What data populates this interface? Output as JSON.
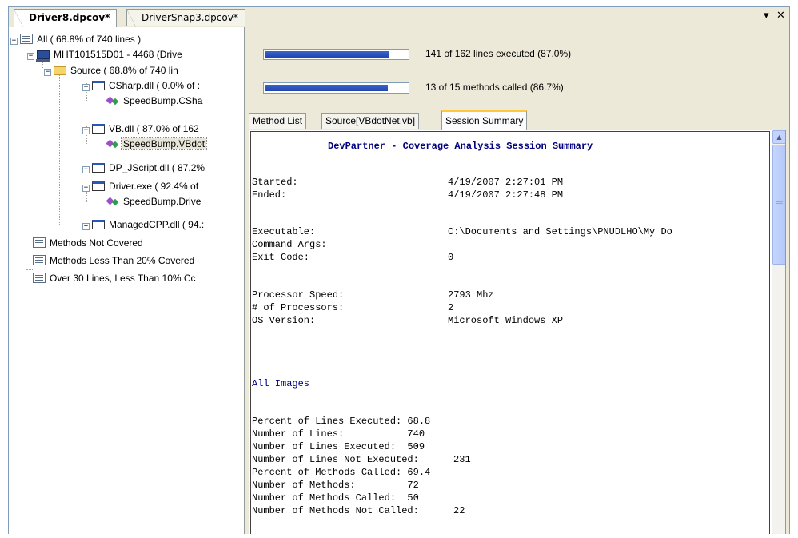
{
  "tabs": [
    {
      "label": "Driver8.dpcov*"
    },
    {
      "label": "DriverSnap3.dpcov*"
    }
  ],
  "controls": {
    "dropdown_icon": "chevron-down-icon",
    "close_icon": "close-icon"
  },
  "tree": {
    "nodes": [
      {
        "label": "All ( 68.8% of 740 lines )",
        "icon": "list-icon"
      },
      {
        "label": "MHT101515D01 - 4468 (Drive",
        "icon": "computer-icon"
      },
      {
        "label": "Source ( 68.8% of 740 lin",
        "icon": "folder-icon"
      },
      {
        "label": "CSharp.dll ( 0.0% of :",
        "icon": "module-icon"
      },
      {
        "label": "SpeedBump.CSha",
        "icon": "class-icon"
      },
      {
        "label": "VB.dll ( 87.0% of 162",
        "icon": "module-icon"
      },
      {
        "label": "SpeedBump.VBdot",
        "icon": "class-icon"
      },
      {
        "label": "DP_JScript.dll ( 87.2%",
        "icon": "module-icon"
      },
      {
        "label": "Driver.exe ( 92.4% of",
        "icon": "module-icon"
      },
      {
        "label": "SpeedBump.Drive",
        "icon": "class-icon"
      },
      {
        "label": "ManagedCPP.dll ( 94.:",
        "icon": "module-icon"
      },
      {
        "label": "Methods Not Covered",
        "icon": "list-icon"
      },
      {
        "label": "Methods Less Than 20% Covered",
        "icon": "list-icon"
      },
      {
        "label": "Over 30 Lines, Less Than 10% Cc",
        "icon": "list-icon"
      }
    ]
  },
  "summary": {
    "lines_bar": {
      "text": "141 of 162 lines executed (87.0%)",
      "fraction": 0.87
    },
    "methods_bar": {
      "text": "13 of 15 methods called (86.7%)",
      "fraction": 0.867
    }
  },
  "view_tabs": [
    {
      "label": "Method List"
    },
    {
      "label": "Source[VBdotNet.vb]"
    },
    {
      "label": "Session Summary"
    }
  ],
  "report": {
    "title": "DevPartner - Coverage Analysis Session Summary",
    "rows1": [
      {
        "k": "Started:",
        "v": "4/19/2007 2:27:01 PM"
      },
      {
        "k": "Ended:",
        "v": "4/19/2007 2:27:48 PM"
      }
    ],
    "rows2": [
      {
        "k": "Executable:",
        "v": "C:\\Documents and Settings\\PNUDLHO\\My Do"
      },
      {
        "k": "Command Args:",
        "v": ""
      },
      {
        "k": "Exit Code:",
        "v": "0"
      }
    ],
    "rows3": [
      {
        "k": "Processor Speed:",
        "v": "2793 Mhz"
      },
      {
        "k": "# of Processors:",
        "v": "2"
      },
      {
        "k": "OS Version:",
        "v": "Microsoft Windows XP"
      }
    ],
    "section": "All Images",
    "stats": [
      "Percent of Lines Executed: 68.8",
      "Number of Lines:           740",
      "Number of Lines Executed:  509",
      "Number of Lines Not Executed:      231",
      "Percent of Methods Called: 69.4",
      "Number of Methods:         72",
      "Number of Methods Called:  50",
      "Number of Methods Not Called:      22"
    ]
  }
}
